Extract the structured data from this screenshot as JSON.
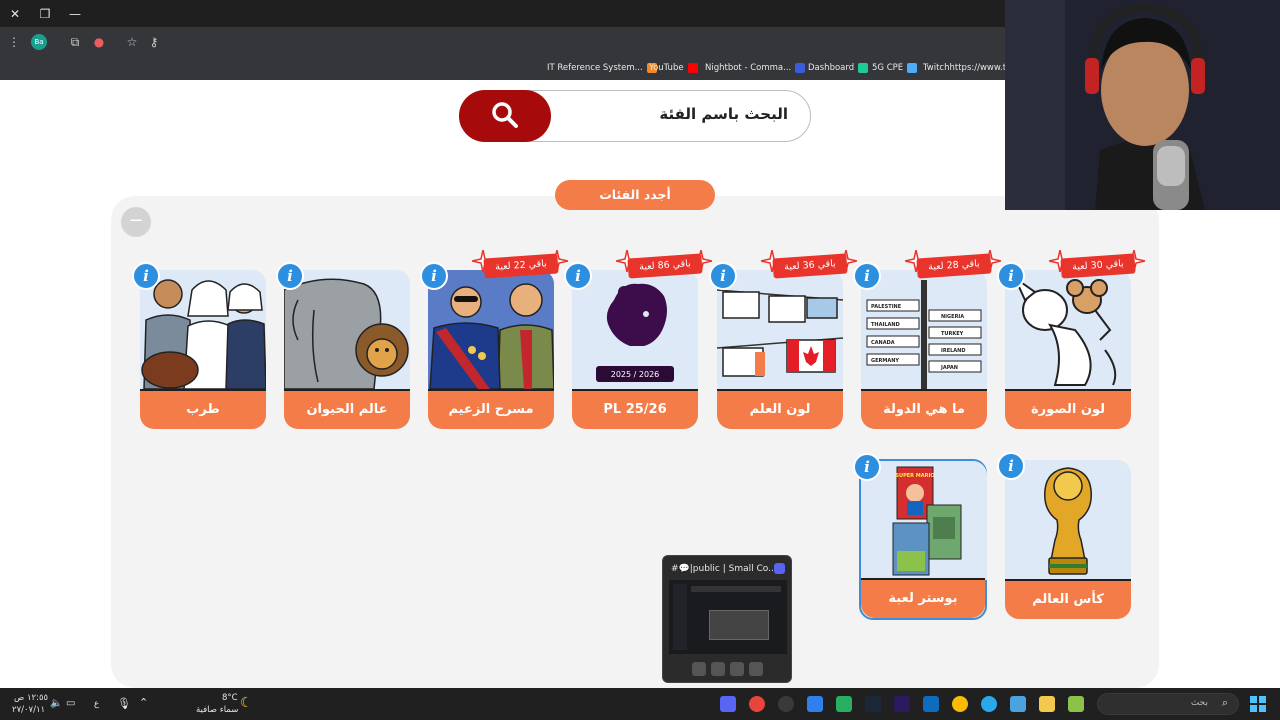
{
  "browser": {
    "bookmarks": [
      {
        "label": "IT Reference System...",
        "color": "#f28b27"
      },
      {
        "label": "YouTube",
        "color": "#ff0000"
      },
      {
        "label": "Nightbot - Comma...",
        "color": "#3b5bdb"
      },
      {
        "label": "Dashboard",
        "color": "#20c997"
      },
      {
        "label": "5G CPE",
        "color": "#4dabf7"
      },
      {
        "label": "Twitchhttps://www.t...",
        "color": "#9146ff"
      }
    ],
    "profile_initials": "Ba"
  },
  "search": {
    "text": "البحث باسم الفئة"
  },
  "newest_button": "أجدد الفئات",
  "categories": [
    {
      "label": "لون الصورة",
      "badge": "باقي 30 لعبة",
      "icon": "cat-mouse-cartoon-icon"
    },
    {
      "label": "ما هي الدولة",
      "badge": "باقي 28 لعبة",
      "icon": "country-signpost-icon",
      "signs": [
        "PALESTINE",
        "NIGERIA",
        "THAILAND",
        "TURKEY",
        "CANADA",
        "IRELAND",
        "GERMANY",
        "JAPAN"
      ]
    },
    {
      "label": "لون العلم",
      "badge": "باقي 36 لعبة",
      "icon": "flags-icon"
    },
    {
      "label": "PL 25/26",
      "badge": "باقي 86 لعبة",
      "icon": "premier-league-icon",
      "season": "2025 / 2026"
    },
    {
      "label": "مسرح الزعيم",
      "badge": "باقي 22 لعبة",
      "icon": "theater-actors-icon"
    },
    {
      "label": "عالم الحيوان",
      "badge": "",
      "icon": "animals-icon"
    },
    {
      "label": "طرب",
      "badge": "",
      "icon": "music-singers-icon"
    },
    {
      "label": "كأس العالم",
      "badge": "",
      "icon": "world-cup-trophy-icon"
    },
    {
      "label": "بوستر لعبة",
      "badge": "",
      "icon": "game-posters-icon",
      "poster_text": "SUPER MARIO"
    }
  ],
  "discord_preview": {
    "title": "#💬|public | Small Co..."
  },
  "taskbar": {
    "time": "١٢:٥٥ ص",
    "date": "٢٧/٠٧/١١",
    "lang": "ع",
    "weather_temp": "8°C",
    "weather_desc": "سماء صافية",
    "search_placeholder": "بحث"
  }
}
